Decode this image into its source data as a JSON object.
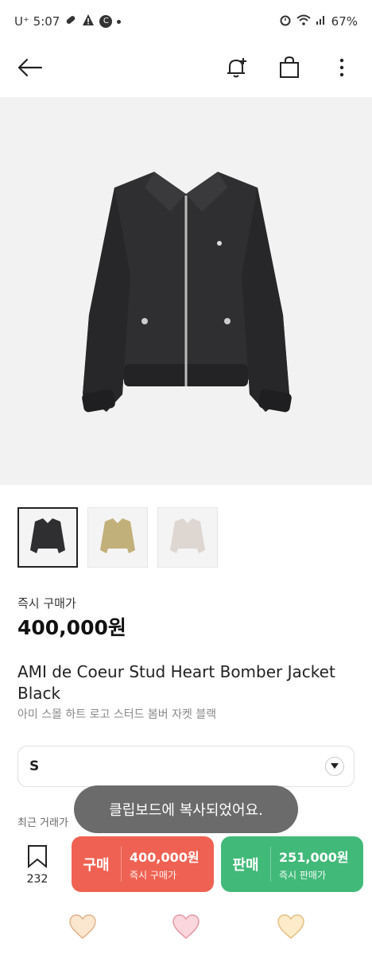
{
  "status_bar": {
    "carrier_time": "U⁺ 5:07",
    "battery": "67%"
  },
  "hero": {
    "alt": "black bomber jacket product image"
  },
  "thumbnails": [
    {
      "color_name": "black"
    },
    {
      "color_name": "khaki"
    },
    {
      "color_name": "light-grey"
    }
  ],
  "price": {
    "label": "즉시 구매가",
    "value": "400,000원"
  },
  "product": {
    "title": "AMI de Coeur Stud Heart Bomber Jacket Black",
    "subtitle": "아미 스몰 하트 로고 스터드 봄버 자켓 블랙"
  },
  "size_select": {
    "value": "S"
  },
  "recent_label": "최근 거래가",
  "toast": "클립보드에 복사되었어요.",
  "wishlist": {
    "count": "232"
  },
  "buy_button": {
    "label": "구매",
    "amount": "400,000원",
    "sub": "즉시 구매가",
    "color": "#ef6253"
  },
  "sell_button": {
    "label": "판매",
    "amount": "251,000원",
    "sub": "즉시 판매가",
    "color": "#41b979"
  }
}
